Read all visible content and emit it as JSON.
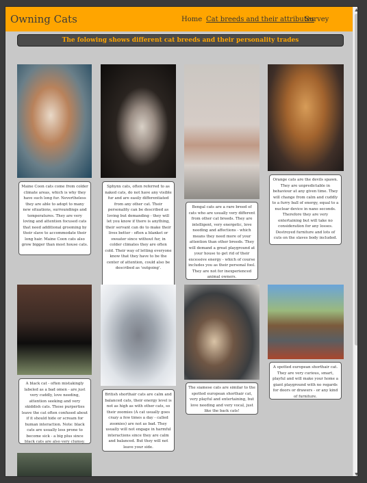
{
  "nav": {
    "brand": "Owning Cats",
    "links": [
      "Home",
      "Cat breeds and their attributes",
      "Survey"
    ]
  },
  "banner": "The folowing shows different cat breeds and their personality trades",
  "cards": [
    {
      "caption": "Maine Coon cats come from colder climate areas, which is why they have such long fur. Nevertheless they are able to adopt to many new situations, surroundings and temperatures. They are very loving and attention focused cats that need additional grooming by their slave to accommodate their long hair. Maine Coon cats also grow bigger than most house cats."
    },
    {
      "caption": "Sphynx cats, often referred to as naked cats, do not have any visible fur and are easily differentiated from any other cat. Their personality can be described as loving but demanding - they will let you know if there is anything, their servant can do to make their lives better - often a blanket or sweater since without fur, in colder climates they are often cold. Their way of letting everyone know that they have to be the center of attention, could also be described as 'outgoing'."
    },
    {
      "caption": "Bengal cats are a rare breed of cats who are usually very different from other cat breeds. They are intelligent, very energetic, love needing and affections - which means they need more of your attention than other breeds. They will demand a great playground at your house to get rid of their excessive energy - which of course includes you as their personal fool. They are not for inexperienced animal owners."
    },
    {
      "caption": "Orange cats are the devils spawn. They are unpredictable in behaviour at any given time. They will change from calm and cuddly to a furry ball of energy, equal to a nuclear device in nano seconds. Therefore they are very entertaining but will take no consideration for any losses. Destroyed furniture and lots of cuts on the slaves body included."
    },
    {
      "caption": "A black cat - often mistakingly labeled as a bad omen - are just very cuddly, love needing, attention seeking and very skiddish cats. These purperties leave the cat often confused about if it should hide or scream for human interaction. Note: black cats are usually less prone to become sick - a big plus since black cats are also very clumsy."
    },
    {
      "caption": "British shorthair cats are calm and balanced cats, their energy level is not as high as with other cats, so their zoomies (A cat usually goes crazy a few times a day - called zoomies) are not as bad. They usually will not engage in harmful interactions since they are calm and balanced. But they will not leave your side."
    },
    {
      "caption": "The siamese cats are similar to the spotted european shorthair cat, very playful and entertaining, but love needing and very vocal, just like the back cats!"
    },
    {
      "caption": "A spotted european shorthair cat. They are very curious, smart, playful and will make your home a giant playground with no regards for doors or drawers - or any kind of furniture."
    }
  ],
  "colors": {
    "navbar": "#ffa500",
    "page_background": "#c8c8c8",
    "banner_background": "#4b4b4b",
    "banner_text": "#ffa500"
  }
}
